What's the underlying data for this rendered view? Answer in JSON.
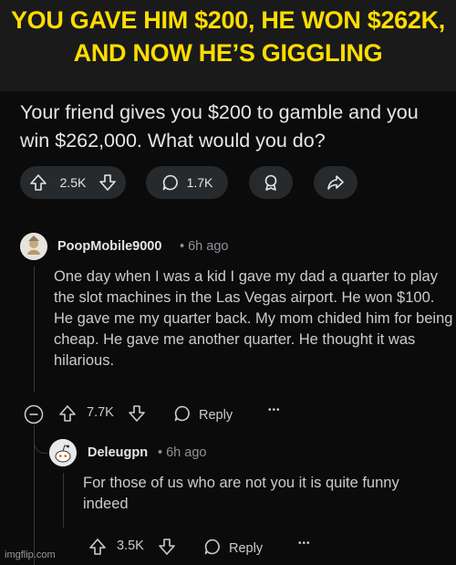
{
  "meme": {
    "caption": "YOU GAVE HIM $200, HE WON $262K, AND NOW HE’S GIGGLING",
    "watermark": "imgflip.com"
  },
  "post": {
    "title": "Your friend gives you $200 to gamble and you win $262,000. What would you do?",
    "votes": "2.5K",
    "comments": "1.7K"
  },
  "comments": [
    {
      "author": "PoopMobile9000",
      "time": "• 6h ago",
      "body": "One day when I was a kid I gave my dad a quarter to play the slot machines in the Las Vegas airport. He won $100. He gave me my quarter back. My mom chided him for being cheap. He gave me another quarter. He thought it was hilarious.",
      "votes": "7.7K",
      "reply_label": "Reply",
      "more": "•••"
    },
    {
      "author": "Deleugpn",
      "time": "• 6h ago",
      "body": "For those of us who are not you it is quite funny indeed",
      "votes": "3.5K",
      "reply_label": "Reply",
      "more": "•••"
    }
  ],
  "colors": {
    "caption": "#ffdd00",
    "background": "#0b0b0c",
    "pill": "#272a2d",
    "text": "#e4e6e8",
    "muted": "#8b9196"
  },
  "icons": [
    "upvote-icon",
    "downvote-icon",
    "comment-icon",
    "award-icon",
    "share-icon",
    "collapse-icon",
    "reply-icon",
    "more-icon"
  ]
}
